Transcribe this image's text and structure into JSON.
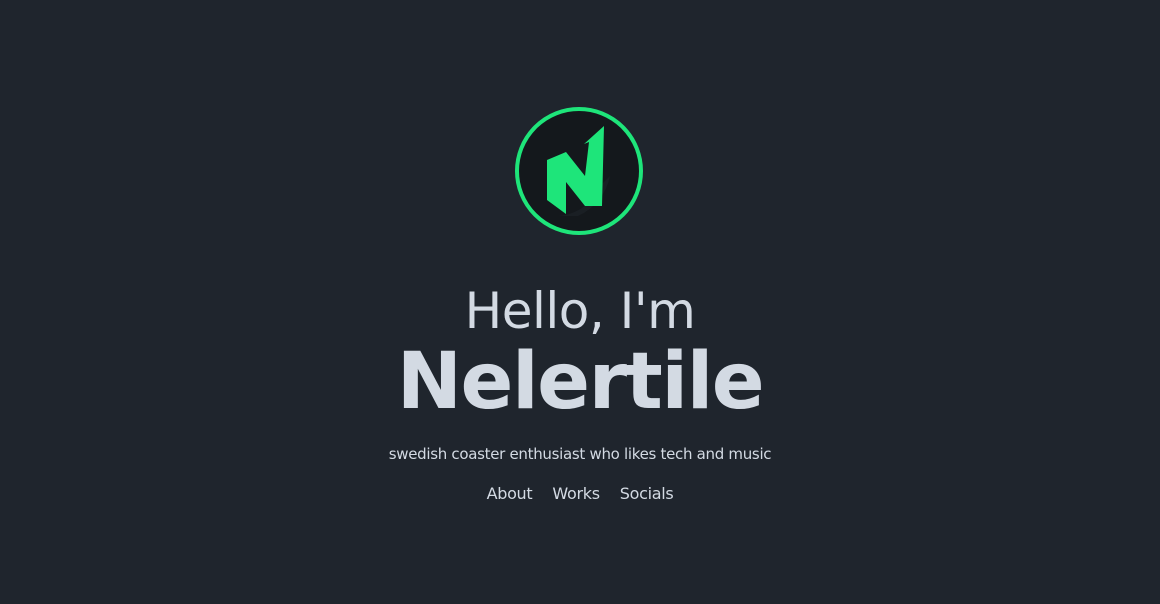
{
  "hero": {
    "logo_icon": "nelertile-n-logo",
    "greeting": "Hello, I'm",
    "name": "Nelertile",
    "tagline": "swedish coaster enthusiast who likes tech and music"
  },
  "nav": {
    "items": [
      {
        "label": "About"
      },
      {
        "label": "Works"
      },
      {
        "label": "Socials"
      }
    ]
  },
  "colors": {
    "background": "#1f252d",
    "text": "#d3dae3",
    "accent": "#1ee57a",
    "logo_fill": "#14181c"
  }
}
